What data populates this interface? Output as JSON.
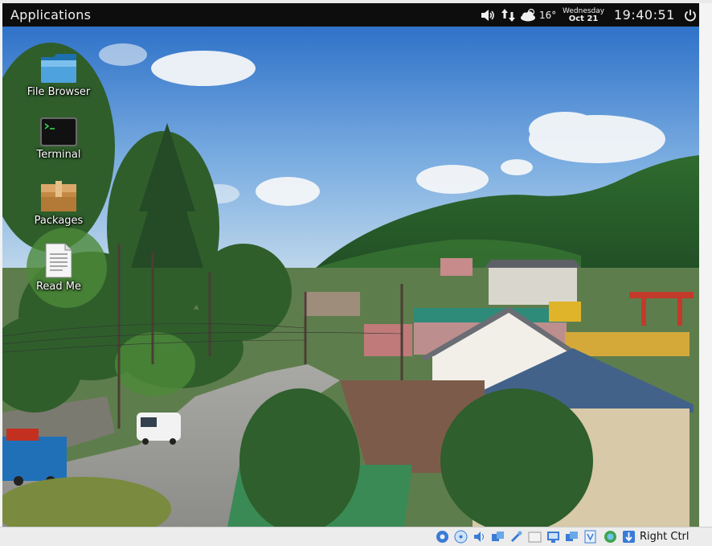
{
  "panel": {
    "apps_label": "Applications",
    "temperature": "16°",
    "weekday": "Wednesday",
    "date": "Oct 21",
    "clock": "19:40:51"
  },
  "desktop": {
    "icons": [
      {
        "label": "File Browser",
        "icon": "folder-icon"
      },
      {
        "label": "Terminal",
        "icon": "terminal-icon"
      },
      {
        "label": "Packages",
        "icon": "package-icon"
      },
      {
        "label": "Read Me",
        "icon": "document-icon"
      }
    ]
  },
  "statusbar": {
    "host_key": "Right Ctrl",
    "indicators": [
      "hard-disk-icon",
      "optical-disk-icon",
      "audio-icon",
      "network-icon",
      "usb-icon",
      "shared-folder-icon",
      "display-icon",
      "video-capture-icon",
      "virtualization-icon",
      "mouse-integration-icon",
      "keyboard-capture-icon"
    ]
  },
  "colors": {
    "panel_bg": "#0d0d0d",
    "sky_top": "#3d7fcf",
    "statusbar_bg": "#ececec"
  }
}
